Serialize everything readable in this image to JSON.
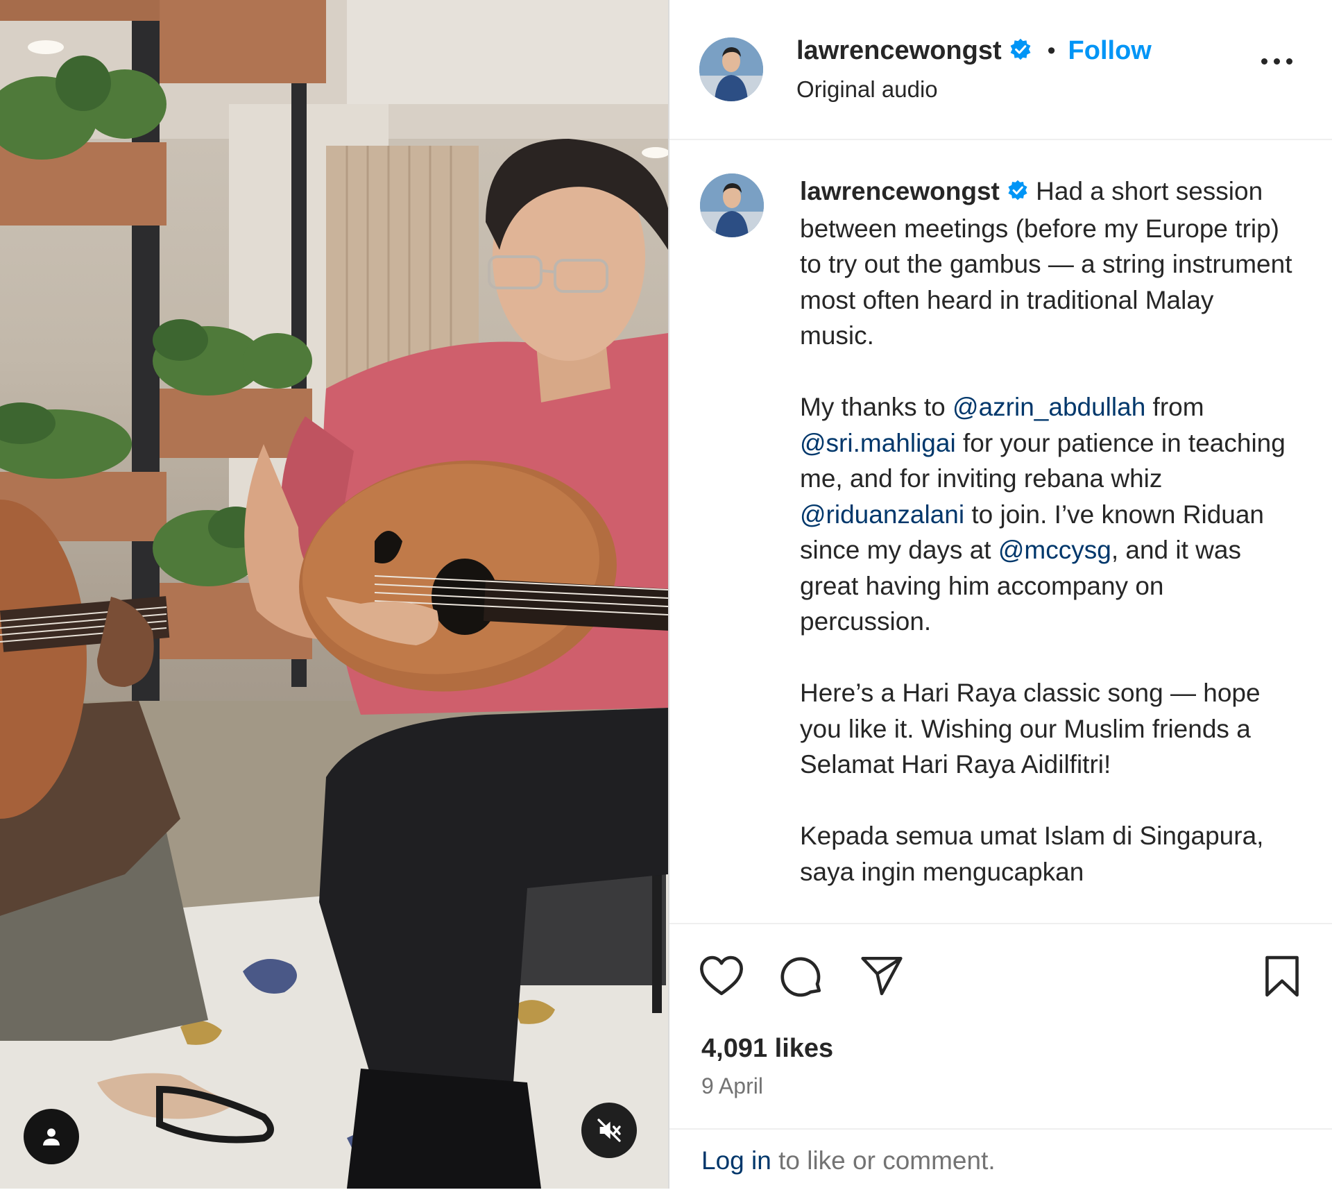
{
  "post": {
    "username": "lawrencewongst",
    "separator": "•",
    "follow_label": "Follow",
    "audio_label": "Original audio",
    "caption_paragraphs": [
      [
        {
          "text": "Had a short session between meetings (before my Europe trip) to try out the gambus — a string instrument most often heard in traditional Malay music."
        }
      ],
      [
        {
          "text": "My thanks to "
        },
        {
          "text": "@azrin_abdullah",
          "mention": true
        },
        {
          "text": " from "
        },
        {
          "text": "@sri.mahligai",
          "mention": true
        },
        {
          "text": " for your patience in teaching me, and for inviting rebana whiz "
        },
        {
          "text": "@riduanzalani",
          "mention": true
        },
        {
          "text": " to join. I’ve known Riduan since my days at "
        },
        {
          "text": "@mccysg",
          "mention": true
        },
        {
          "text": ", and it was great having him accompany on percussion."
        }
      ],
      [
        {
          "text": "Here’s a Hari Raya classic song — hope you like it. Wishing our Muslim friends a Selamat Hari Raya Aidilfitri!"
        }
      ],
      [
        {
          "text": "Kepada semua umat Islam di Singapura, saya ingin mengucapkan"
        }
      ]
    ],
    "likes": "4,091 likes",
    "date": "9 April",
    "footer": {
      "login_label": "Log in",
      "rest": " to like or comment."
    }
  },
  "icons": {
    "verified": "verified-badge-icon",
    "more": "more-options-icon",
    "like": "heart-icon",
    "comment": "comment-icon",
    "share": "share-icon",
    "save": "bookmark-icon",
    "mute": "muted-speaker-icon",
    "tagged": "person-tag-icon"
  },
  "colors": {
    "accent": "#0095f6",
    "mention": "#00376b",
    "verified": "#0095f6",
    "secondary_text": "#737373"
  }
}
